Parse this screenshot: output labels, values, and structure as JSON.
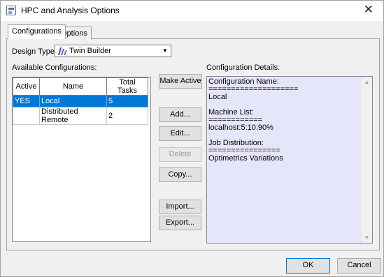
{
  "window": {
    "title": "HPC and Analysis Options",
    "close_glyph": "✕"
  },
  "tabs": [
    {
      "label": "Configurations",
      "active": true
    },
    {
      "label": "Options",
      "active": false
    }
  ],
  "design_type": {
    "label": "Design Type:",
    "value": "Twin Builder",
    "icon": "twin-builder-icon"
  },
  "available": {
    "label": "Available Configurations:",
    "columns": [
      "Active",
      "Name",
      "Total Tasks"
    ],
    "rows": [
      {
        "active": "YES",
        "name": "Local",
        "tasks": "5",
        "selected": true
      },
      {
        "active": "",
        "name": "Distributed Remote",
        "tasks": "2",
        "selected": false
      }
    ]
  },
  "buttons": {
    "make_active": "Make Active",
    "add": "Add...",
    "edit": "Edit...",
    "delete": "Delete",
    "copy": "Copy...",
    "import": "Import...",
    "export": "Export..."
  },
  "details": {
    "label": "Configuration Details:",
    "text": "Configuration Name:\n====================\nLocal\n\nMachine List:\n============\nlocalhost:5:10:90%\n\nJob Distribution:\n================\nOptimetrics Variations"
  },
  "footer": {
    "ok": "OK",
    "cancel": "Cancel"
  },
  "colors": {
    "selection": "#0078d7",
    "details_bg": "#e6e6fa"
  }
}
